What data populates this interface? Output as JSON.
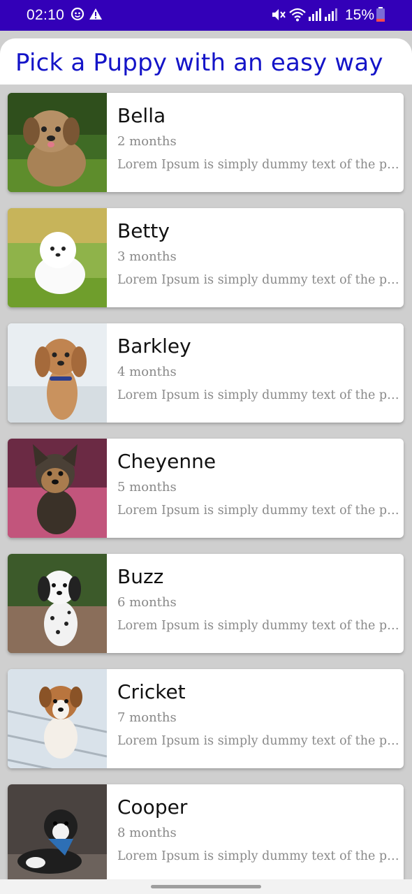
{
  "status_bar": {
    "time": "02:10",
    "battery": "15%",
    "background_color": "#3300b8",
    "icons": [
      "notification-sync-icon",
      "warning-icon",
      "mute-icon",
      "wifi-icon",
      "signal-icon",
      "signal-icon-2",
      "battery-icon"
    ]
  },
  "header": {
    "title": "Pick a Puppy with an easy way",
    "title_color": "#1414c8"
  },
  "puppies": [
    {
      "name": "Bella",
      "age": "2 months",
      "description": "Lorem Ipsum is simply dummy text of the printing and typesetting industry."
    },
    {
      "name": "Betty",
      "age": "3 months",
      "description": "Lorem Ipsum is simply dummy text of the printing and typesetting industry."
    },
    {
      "name": "Barkley",
      "age": "4 months",
      "description": "Lorem Ipsum is simply dummy text of the printing and typesetting industry."
    },
    {
      "name": "Cheyenne",
      "age": "5 months",
      "description": "Lorem Ipsum is simply dummy text of the printing and typesetting industry."
    },
    {
      "name": "Buzz",
      "age": "6 months",
      "description": "Lorem Ipsum is simply dummy text of the printing and typesetting industry."
    },
    {
      "name": "Cricket",
      "age": "7 months",
      "description": "Lorem Ipsum is simply dummy text of the printing and typesetting industry."
    },
    {
      "name": "Cooper",
      "age": "8 months",
      "description": "Lorem Ipsum is simply dummy text of the printing and typesetting industry."
    }
  ]
}
